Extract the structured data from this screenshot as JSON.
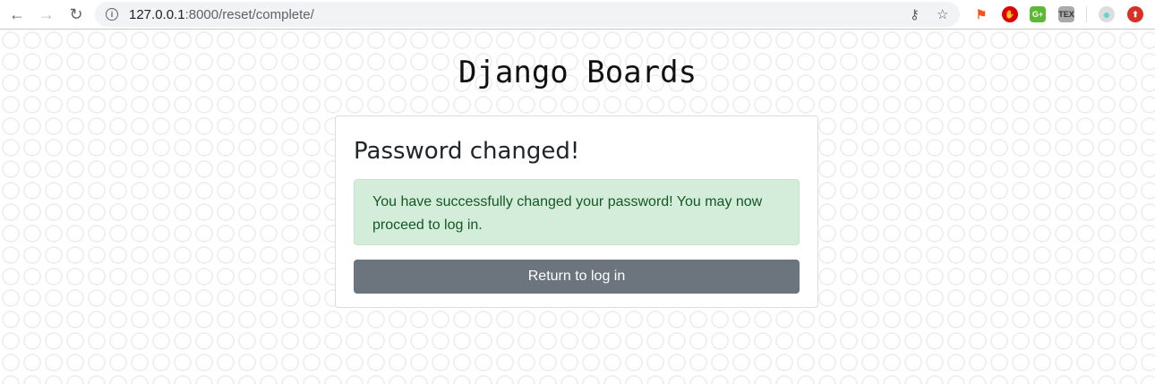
{
  "browser": {
    "url_host": "127.0.0.1",
    "url_rest": ":8000/reset/complete/"
  },
  "extensions": [
    {
      "name": "sitemap",
      "color": "#f4511e",
      "label": "⚑"
    },
    {
      "name": "adblock",
      "color": "#e00000",
      "label": "✋"
    },
    {
      "name": "google-plus",
      "color": "#5cb936",
      "label": "G+"
    },
    {
      "name": "tex",
      "color": "#aaaaaa",
      "label": "TEX"
    }
  ],
  "header": {
    "brand": "Django Boards"
  },
  "card": {
    "title": "Password changed!",
    "message": "You have successfully changed your password! You may now proceed to log in.",
    "button": "Return to log in"
  },
  "colors": {
    "alert_bg": "#d4edda",
    "button": "#6c757d"
  }
}
